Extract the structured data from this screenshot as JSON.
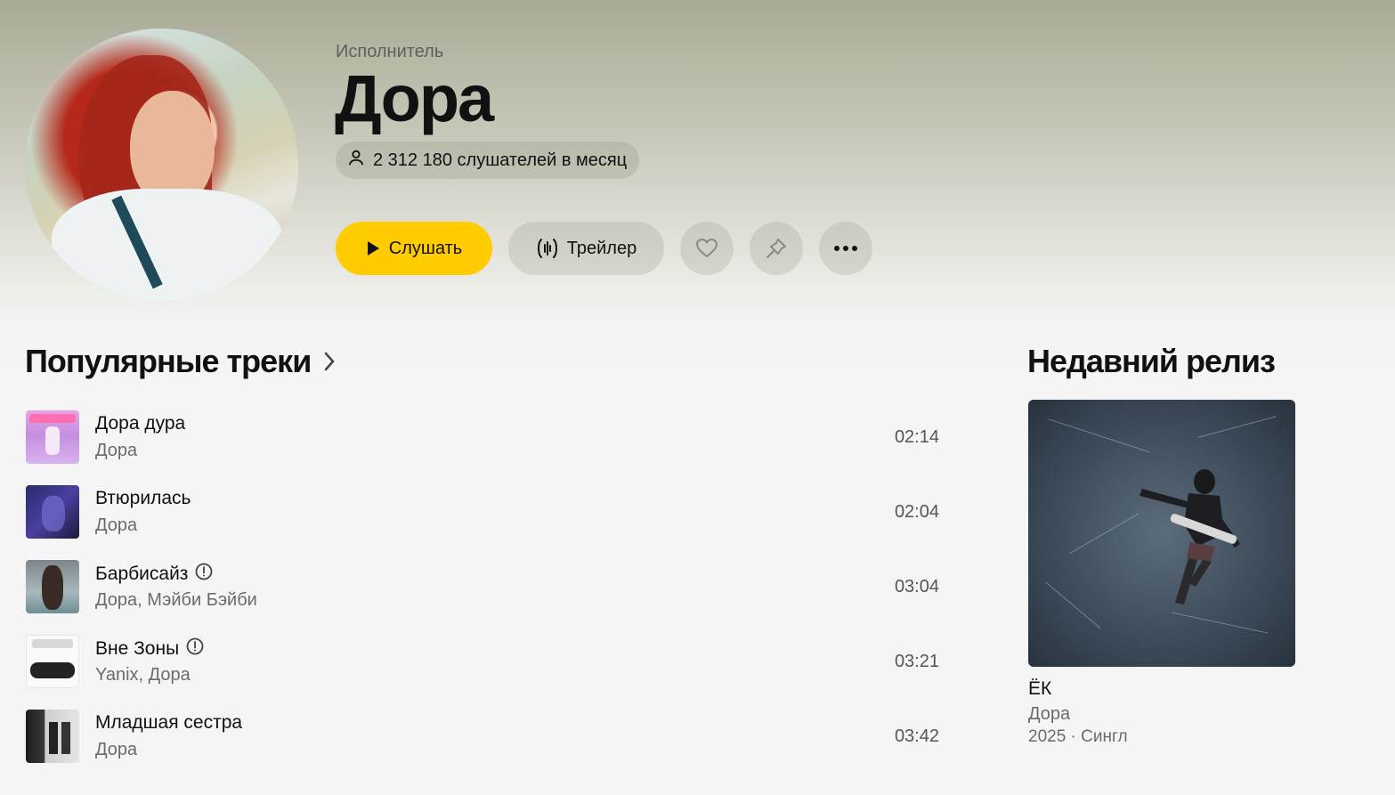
{
  "header": {
    "eyebrow": "Исполнитель",
    "artist_name": "Дора",
    "listeners": "2 312 180 слушателей в месяц"
  },
  "actions": {
    "play_label": "Слушать",
    "trailer_label": "Трейлер",
    "like_icon": "heart-icon",
    "pin_icon": "pin-icon",
    "more_icon": "more-icon"
  },
  "popular": {
    "title": "Популярные треки",
    "tracks": [
      {
        "title": "Дора дура",
        "artists": "Дора",
        "duration": "02:14",
        "explicit": false
      },
      {
        "title": "Втюрилась",
        "artists": "Дора",
        "duration": "02:04",
        "explicit": false
      },
      {
        "title": "Барбисайз",
        "artists": "Дора, Мэйби Бэйби",
        "duration": "03:04",
        "explicit": true
      },
      {
        "title": "Вне Зоны",
        "artists": "Yanix, Дора",
        "duration": "03:21",
        "explicit": true
      },
      {
        "title": "Младшая сестра",
        "artists": "Дора",
        "duration": "03:42",
        "explicit": false
      }
    ]
  },
  "release": {
    "section_title": "Недавний релиз",
    "title": "ЁК",
    "artist": "Дора",
    "meta": "2025 · Сингл"
  },
  "colors": {
    "accent": "#ffcc00",
    "background": "#f5f5f5",
    "header_tint": "#a9aa96"
  }
}
